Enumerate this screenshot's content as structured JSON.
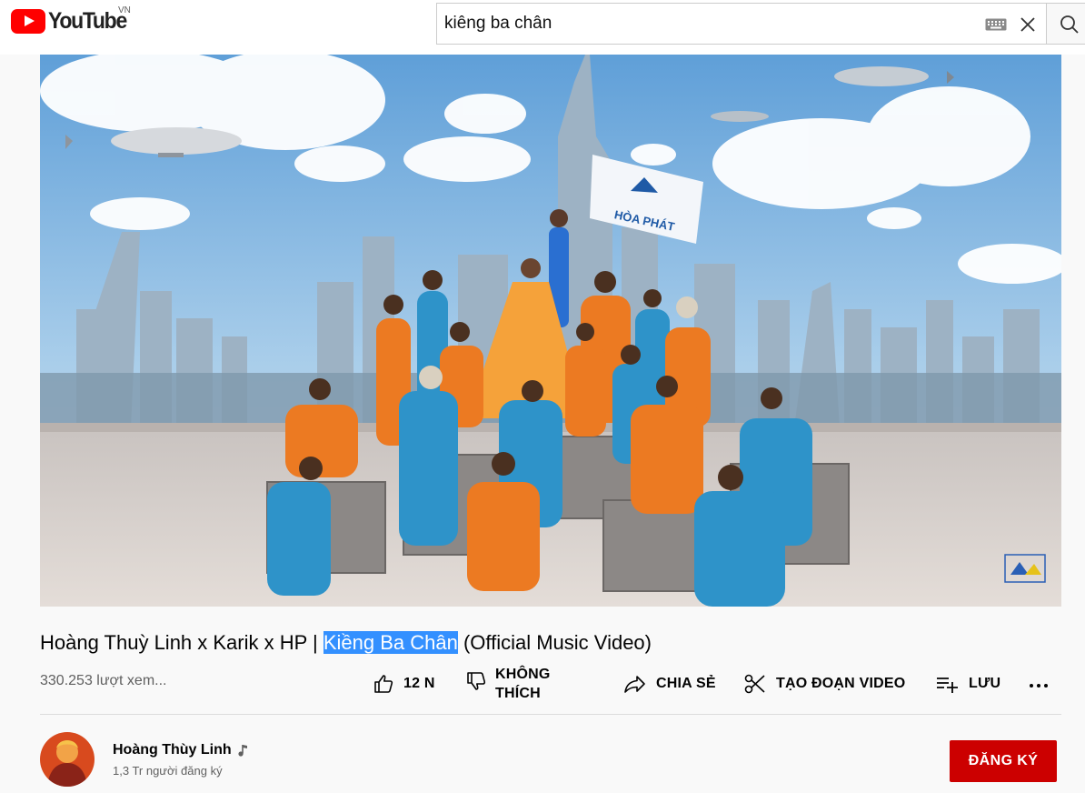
{
  "masthead": {
    "logo_text": "YouTube",
    "region": "VN",
    "search": {
      "value": "kiêng ba chân"
    },
    "icons": [
      "keyboard-icon",
      "close-icon",
      "search-icon"
    ]
  },
  "video": {
    "title_before": "Hoàng Thuỳ Linh x Karik x HP | ",
    "title_highlight": "Kiềng Ba Chân",
    "title_after": " (Official Music Video)",
    "flag_text": "HÒA PHÁT",
    "views": "330.253 lượt xem..."
  },
  "actions": {
    "like_count": "12 N",
    "dislike_line1": "KHÔNG",
    "dislike_line2": "THÍCH",
    "share": "CHIA SẺ",
    "clip": "TẠO ĐOẠN VIDEO",
    "save": "LƯU"
  },
  "channel": {
    "name": "Hoàng Thùy Linh",
    "subscribers": "1,3 Tr người đăng ký",
    "subscribe_label": "ĐĂNG KÝ"
  },
  "colors": {
    "brand_red": "#ff0000",
    "subscribe_red": "#cc0000",
    "highlight_blue": "#3390ff"
  }
}
